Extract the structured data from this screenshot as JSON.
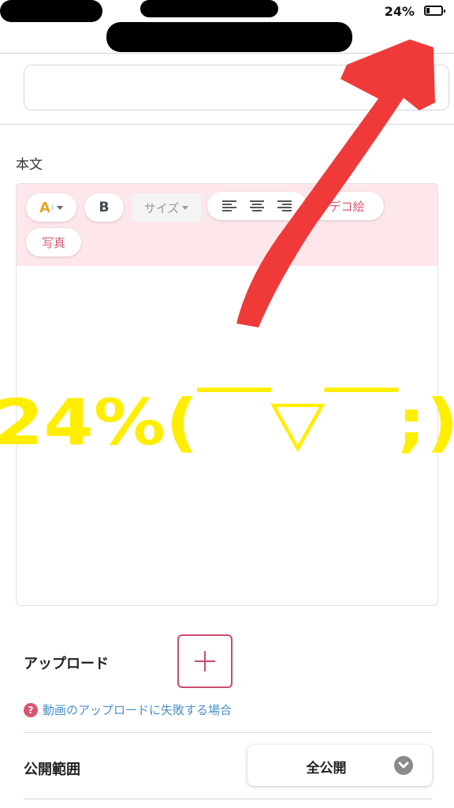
{
  "status": {
    "battery_percent_text": "24%",
    "battery_level": 0.24
  },
  "editor": {
    "section_label": "本文",
    "toolbar": {
      "font_color_label": "A",
      "bold_label": "B",
      "size_label": "サイズ",
      "deco_label": "デコ絵",
      "photo_label": "写真"
    },
    "handwritten_annotation": "24%(￣▽￣;)"
  },
  "upload": {
    "label": "アップロード",
    "help_icon": "?",
    "help_link": "動画のアップロードに失敗する場合"
  },
  "visibility": {
    "label": "公開範囲",
    "value": "全公開"
  },
  "colors": {
    "toolbar_bg": "#fde7ea",
    "accent_pink": "#c94c6d",
    "link_blue": "#4a8fc9",
    "annotation_red": "#f03a3a",
    "annotation_yellow": "#ffee00"
  }
}
